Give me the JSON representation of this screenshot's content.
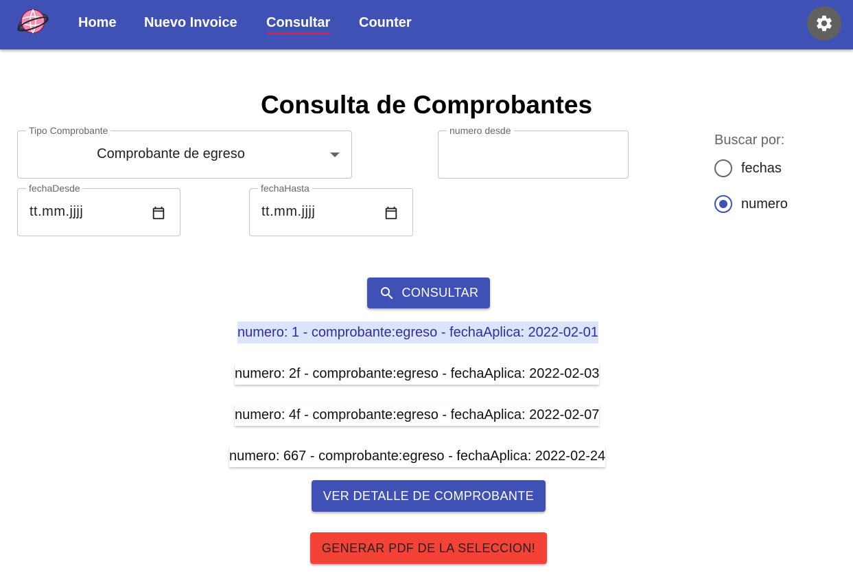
{
  "nav": {
    "items": [
      {
        "label": "Home"
      },
      {
        "label": "Nuevo Invoice"
      },
      {
        "label": "Consultar",
        "active": true
      },
      {
        "label": "Counter"
      }
    ]
  },
  "page": {
    "title": "Consulta de Comprobantes"
  },
  "form": {
    "tipo": {
      "label": "Tipo Comprobante",
      "value": "Comprobante de egreso"
    },
    "numero_desde": {
      "label": "numero desde",
      "value": ""
    },
    "fecha_desde": {
      "label": "fechaDesde",
      "value": "tt.mm.jjjj"
    },
    "fecha_hasta": {
      "label": "fechaHasta",
      "value": "tt.mm.jjjj"
    },
    "buscar_por": {
      "label": "Buscar por:",
      "options": [
        {
          "label": "fechas",
          "checked": false
        },
        {
          "label": "numero",
          "checked": true
        }
      ]
    }
  },
  "actions": {
    "consultar_label": "CONSULTAR",
    "ver_detalle_label": "VER DETALLE DE COMPROBANTE",
    "generar_pdf_label": "GENERAR PDF DE LA SELECCION!"
  },
  "results": [
    {
      "text": "numero: 1 - comprobante:egreso - fechaAplica: 2022-02-01",
      "selected": true
    },
    {
      "text": "numero: 2f - comprobante:egreso - fechaAplica: 2022-02-03",
      "selected": false
    },
    {
      "text": "numero: 4f - comprobante:egreso - fechaAplica: 2022-02-07",
      "selected": false
    },
    {
      "text": "numero: 667 - comprobante:egreso - fechaAplica: 2022-02-24",
      "selected": false
    }
  ],
  "colors": {
    "primary": "#3f51b5",
    "danger": "#f44336",
    "active_underline": "#e91e3f",
    "selected_bg": "#dbe4fb"
  },
  "icons": {
    "logo": "globe-logo-icon",
    "settings": "gear-icon",
    "calendar": "calendar-icon",
    "search": "search-icon",
    "dropdown": "chevron-down-icon"
  }
}
